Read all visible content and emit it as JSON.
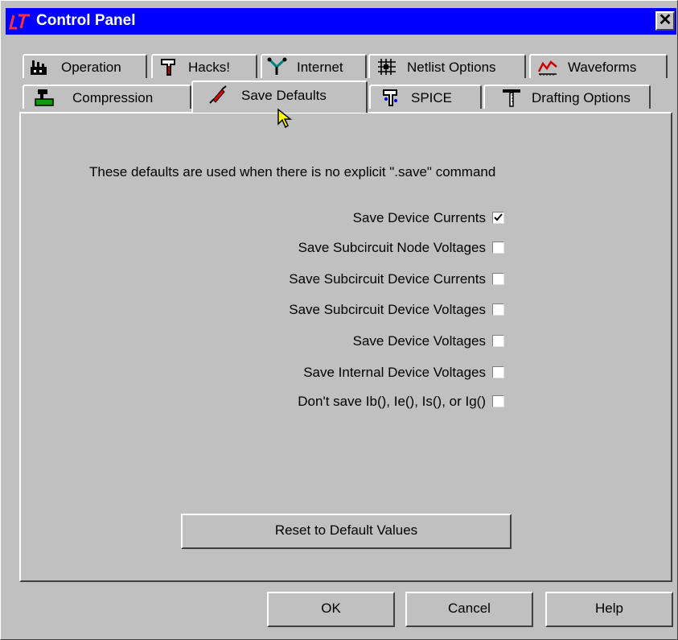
{
  "window": {
    "title": "Control Panel",
    "close_glyph": "✕",
    "logo_icon": "ltspice-logo-icon"
  },
  "tabs_row1": [
    {
      "label": "Operation",
      "icon": "factory-icon"
    },
    {
      "label": "Hacks!",
      "icon": "hammer-icon"
    },
    {
      "label": "Internet",
      "icon": "network-icon"
    },
    {
      "label": "Netlist Options",
      "icon": "grid-icon"
    },
    {
      "label": "Waveforms",
      "icon": "waveform-icon"
    }
  ],
  "tabs_row2": [
    {
      "label": "Compression",
      "icon": "compression-icon"
    },
    {
      "label": "Save Defaults",
      "icon": "syringe-icon",
      "active": true
    },
    {
      "label": "SPICE",
      "icon": "spice-icon"
    },
    {
      "label": "Drafting Options",
      "icon": "drafting-icon"
    }
  ],
  "panel": {
    "intro": "These defaults are used when there is no explicit \".save\" command",
    "options": [
      {
        "label": "Save Device Currents",
        "checked": true
      },
      {
        "label": "Save Subcircuit Node Voltages",
        "checked": false
      },
      {
        "label": "Save Subcircuit Device Currents",
        "checked": false
      },
      {
        "label": "Save Subcircuit Device Voltages",
        "checked": false
      },
      {
        "label": "Save Device Voltages",
        "checked": false
      },
      {
        "label": "Save Internal Device Voltages",
        "checked": false
      },
      {
        "label": "Don't save Ib(), Ie(), Is(), or Ig()",
        "checked": false
      }
    ],
    "reset_label": "Reset to Default Values"
  },
  "footer": {
    "ok_label": "OK",
    "cancel_label": "Cancel",
    "help_label": "Help"
  },
  "colors": {
    "titlebar": "#0000ff",
    "face": "#c0c0c0",
    "accent_red": "#cc0000"
  }
}
